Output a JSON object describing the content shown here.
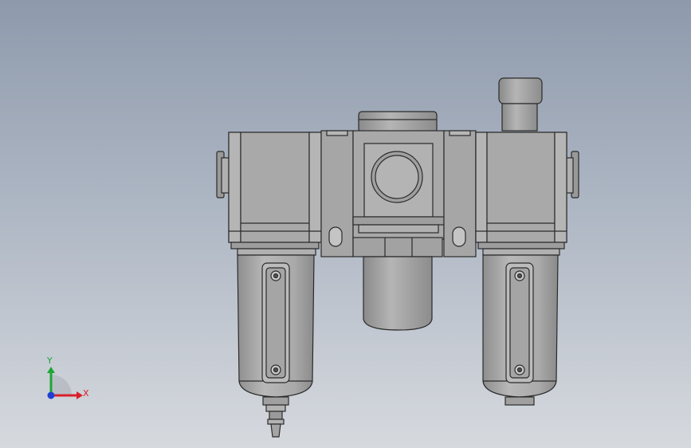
{
  "viewport": {
    "background_top": "#8e9aac",
    "background_bottom": "#d6d9de",
    "model_color": "#a7a7a7",
    "edge_color": "#2b2b2b"
  },
  "model": {
    "parts": [
      "filter",
      "regulator",
      "lubricator"
    ],
    "filter": {
      "components": [
        "body",
        "bowl",
        "sight-glass",
        "drain-fitting"
      ]
    },
    "regulator": {
      "components": [
        "bonnet",
        "pressure-gauge",
        "lock-nut",
        "bowl"
      ]
    },
    "lubricator": {
      "components": [
        "body",
        "fill-plug",
        "bowl",
        "sight-glass"
      ]
    }
  },
  "triad": {
    "x_label": "X",
    "y_label": "Y",
    "x_color": "#d9202a",
    "y_color": "#1ea534",
    "z_color": "#1f3fd4"
  }
}
